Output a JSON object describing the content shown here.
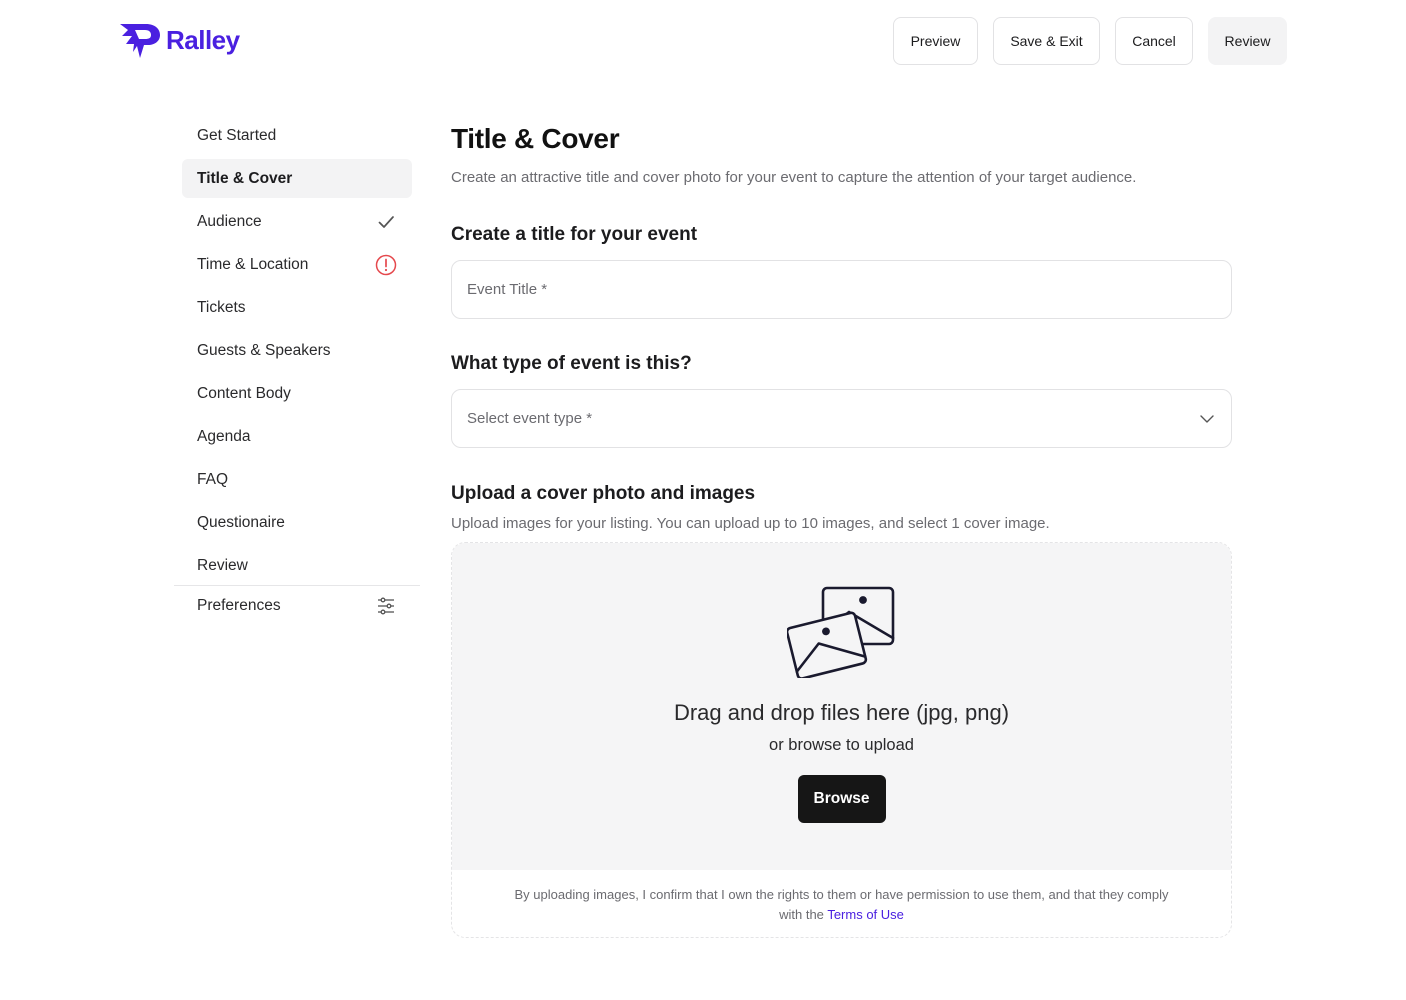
{
  "brand": {
    "name": "Ralley",
    "color": "#4a20e0"
  },
  "header": {
    "actions": [
      "Preview",
      "Save & Exit",
      "Cancel",
      "Review"
    ]
  },
  "sidebar": {
    "items": [
      {
        "label": "Get Started",
        "status": ""
      },
      {
        "label": "Title & Cover",
        "status": "active"
      },
      {
        "label": "Audience",
        "status": "complete",
        "icon": "check-icon"
      },
      {
        "label": "Time & Location",
        "status": "error",
        "icon": "alert-circle-icon",
        "color": "#e5484d"
      },
      {
        "label": "Tickets",
        "status": ""
      },
      {
        "label": "Guests & Speakers",
        "status": ""
      },
      {
        "label": "Content Body",
        "status": ""
      },
      {
        "label": "Agenda",
        "status": ""
      },
      {
        "label": "FAQ",
        "status": ""
      },
      {
        "label": "Questionaire",
        "status": ""
      },
      {
        "label": "Review",
        "status": ""
      }
    ],
    "preferences": {
      "label": "Preferences",
      "icon": "sliders-icon"
    }
  },
  "main": {
    "title": "Title & Cover",
    "subtitle": "Create an attractive title and cover photo for your event to capture the attention of your target audience.",
    "title_section": {
      "heading": "Create a title for your event",
      "placeholder": "Event Title *"
    },
    "type_section": {
      "heading": "What type of event is this?",
      "selected": "Select event type *"
    },
    "upload_section": {
      "heading": "Upload a cover photo and images",
      "subtitle": "Upload images for your listing. You can upload up to 10 images, and select 1 cover image.",
      "drop_title": "Drag and drop files here (jpg, png)",
      "drop_sub": "or browse to upload",
      "browse_label": "Browse",
      "disclaimer": "By uploading images, I confirm that I own the rights to them or have permission to use them, and that they comply",
      "disclaimer_line2": "with the",
      "terms_label": "Terms of Use"
    }
  }
}
